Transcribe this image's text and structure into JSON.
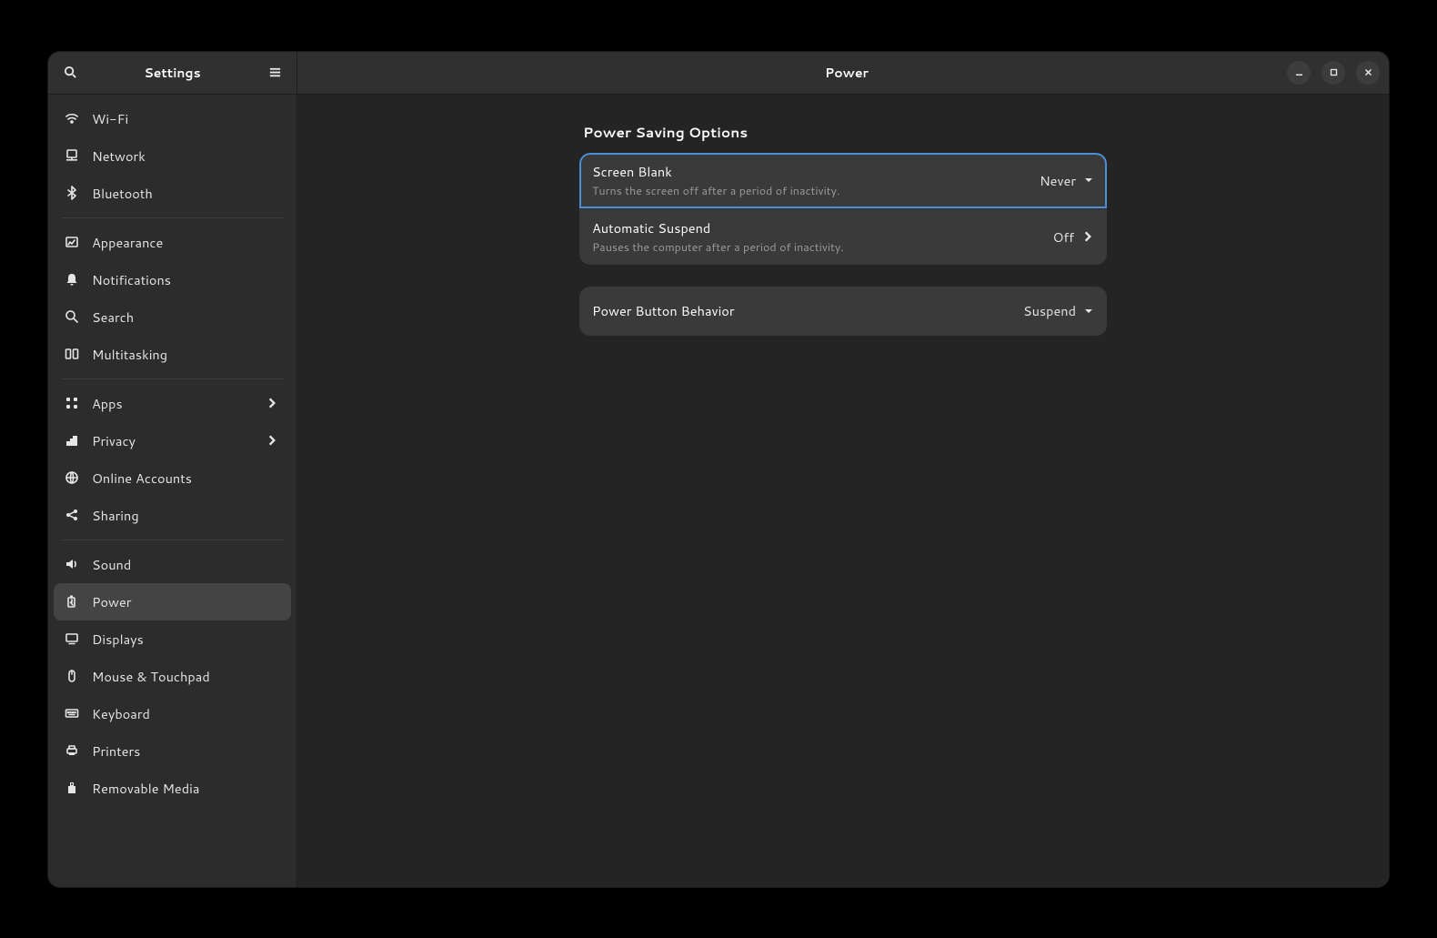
{
  "sidebar": {
    "title": "Settings",
    "items": [
      {
        "label": "Wi-Fi",
        "icon": "wifi"
      },
      {
        "label": "Network",
        "icon": "network"
      },
      {
        "label": "Bluetooth",
        "icon": "bluetooth"
      },
      {
        "label": "Appearance",
        "icon": "appearance",
        "separator_before": true
      },
      {
        "label": "Notifications",
        "icon": "bell"
      },
      {
        "label": "Search",
        "icon": "search"
      },
      {
        "label": "Multitasking",
        "icon": "multitask"
      },
      {
        "label": "Apps",
        "icon": "apps",
        "has_chevron": true,
        "separator_before": true
      },
      {
        "label": "Privacy",
        "icon": "privacy",
        "has_chevron": true
      },
      {
        "label": "Online Accounts",
        "icon": "online"
      },
      {
        "label": "Sharing",
        "icon": "share"
      },
      {
        "label": "Sound",
        "icon": "sound",
        "separator_before": true
      },
      {
        "label": "Power",
        "icon": "power",
        "active": true
      },
      {
        "label": "Displays",
        "icon": "display"
      },
      {
        "label": "Mouse & Touchpad",
        "icon": "mouse"
      },
      {
        "label": "Keyboard",
        "icon": "keyboard"
      },
      {
        "label": "Printers",
        "icon": "printer"
      },
      {
        "label": "Removable Media",
        "icon": "removable"
      }
    ]
  },
  "main": {
    "title": "Power",
    "section_title": "Power Saving Options",
    "rows": {
      "screen_blank": {
        "title": "Screen Blank",
        "subtitle": "Turns the screen off after a period of inactivity.",
        "value": "Never"
      },
      "auto_suspend": {
        "title": "Automatic Suspend",
        "subtitle": "Pauses the computer after a period of inactivity.",
        "value": "Off"
      },
      "power_button": {
        "title": "Power Button Behavior",
        "value": "Suspend"
      }
    }
  }
}
